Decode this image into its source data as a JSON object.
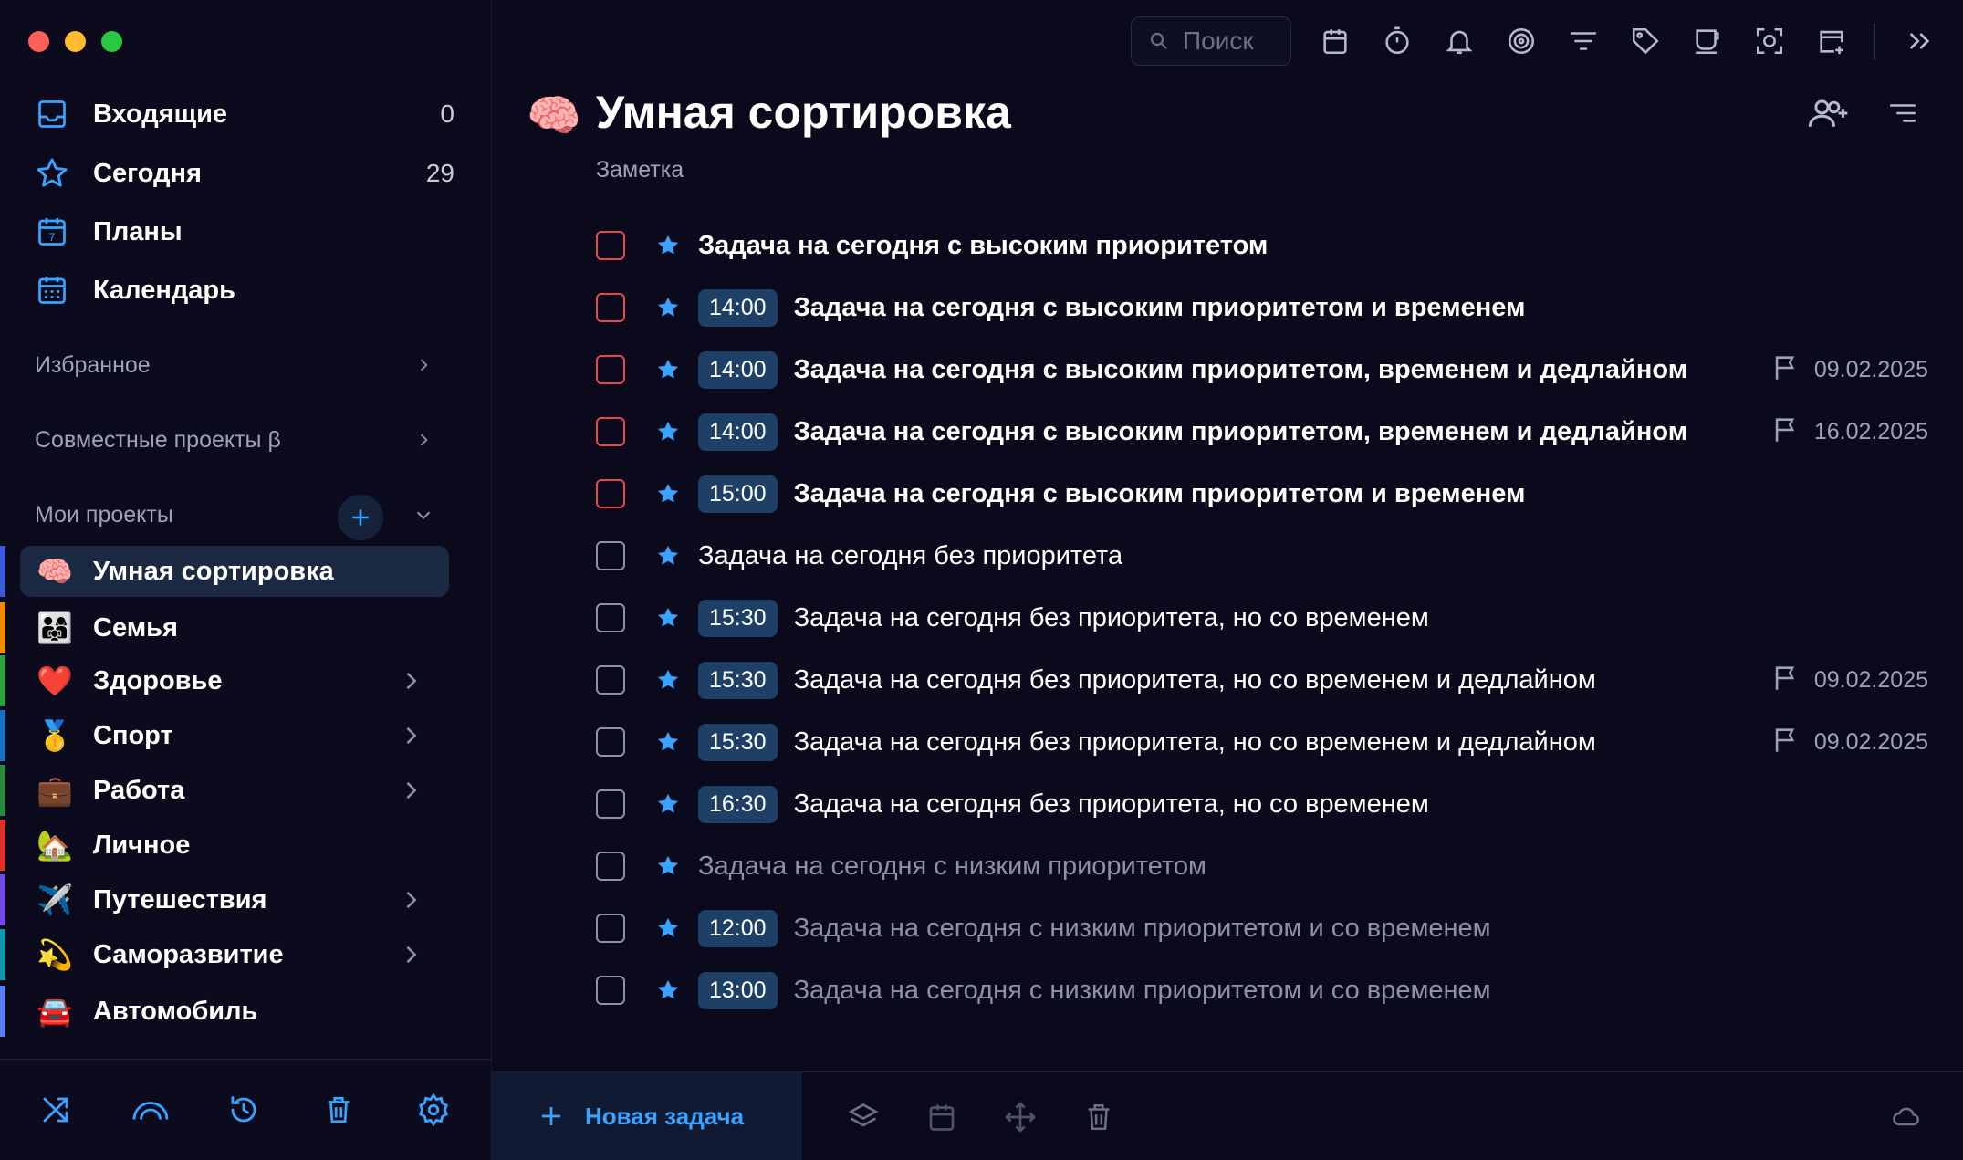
{
  "colors": {
    "accent": "#3aa3ff",
    "high_priority": "#e5484d",
    "time_badge": "#1e4066",
    "active_project": "#1b2942"
  },
  "sidebar": {
    "nav": [
      {
        "label": "Входящие",
        "count": "0",
        "icon": "inbox-icon"
      },
      {
        "label": "Сегодня",
        "count": "29",
        "icon": "star-icon"
      },
      {
        "label": "Планы",
        "count": "",
        "icon": "calendar-7-icon"
      },
      {
        "label": "Календарь",
        "count": "",
        "icon": "calendar-grid-icon"
      }
    ],
    "sections": {
      "favorites": "Избранное",
      "shared": "Совместные проекты β",
      "my_projects": "Мои проекты"
    },
    "projects": [
      {
        "label": "Умная сортировка",
        "emoji": "🧠",
        "bar": "#3b5bdb",
        "chevron": false,
        "active": true
      },
      {
        "label": "Семья",
        "emoji": "👨‍👩‍👧",
        "bar": "#f08c00",
        "chevron": false,
        "active": false
      },
      {
        "label": "Здоровье",
        "emoji": "❤️",
        "bar": "#2f9e44",
        "chevron": true,
        "active": false
      },
      {
        "label": "Спорт",
        "emoji": "🥇",
        "bar": "#1971c2",
        "chevron": true,
        "active": false
      },
      {
        "label": "Работа",
        "emoji": "💼",
        "bar": "#2b8a3e",
        "chevron": true,
        "active": false
      },
      {
        "label": "Личное",
        "emoji": "🏡",
        "bar": "#e03131",
        "chevron": false,
        "active": false
      },
      {
        "label": "Путешествия",
        "emoji": "✈️",
        "bar": "#7048e8",
        "chevron": true,
        "active": false
      },
      {
        "label": "Саморазвитие",
        "emoji": "💫",
        "bar": "#1098ad",
        "chevron": true,
        "active": false
      },
      {
        "label": "Автомобиль",
        "emoji": "🚘",
        "bar": "#5c7cfa",
        "chevron": false,
        "active": false
      }
    ]
  },
  "toolbar": {
    "search_placeholder": "Поиск"
  },
  "header": {
    "emoji": "🧠",
    "title": "Умная сортировка",
    "note": "Заметка"
  },
  "tasks": [
    {
      "title": "Задача на сегодня с высоким приоритетом",
      "time": "",
      "deadline": "",
      "priority": "high"
    },
    {
      "title": "Задача на сегодня с высоким приоритетом и временем",
      "time": "14:00",
      "deadline": "",
      "priority": "high"
    },
    {
      "title": "Задача на сегодня с высоким приоритетом, временем и дедлайном",
      "time": "14:00",
      "deadline": "09.02.2025",
      "priority": "high"
    },
    {
      "title": "Задача на сегодня с высоким приоритетом, временем и дедлайном",
      "time": "14:00",
      "deadline": "16.02.2025",
      "priority": "high"
    },
    {
      "title": "Задача на сегодня с высоким приоритетом и временем",
      "time": "15:00",
      "deadline": "",
      "priority": "high"
    },
    {
      "title": "Задача на сегодня без приоритета",
      "time": "",
      "deadline": "",
      "priority": "none"
    },
    {
      "title": "Задача на сегодня без приоритета, но со временем",
      "time": "15:30",
      "deadline": "",
      "priority": "none"
    },
    {
      "title": "Задача на сегодня без приоритета, но со временем и дедлайном",
      "time": "15:30",
      "deadline": "09.02.2025",
      "priority": "none"
    },
    {
      "title": "Задача на сегодня без приоритета, но со временем и дедлайном",
      "time": "15:30",
      "deadline": "09.02.2025",
      "priority": "none"
    },
    {
      "title": "Задача на сегодня без приоритета, но со временем",
      "time": "16:30",
      "deadline": "",
      "priority": "none"
    },
    {
      "title": "Задача на сегодня с низким приоритетом",
      "time": "",
      "deadline": "",
      "priority": "low"
    },
    {
      "title": "Задача на сегодня с низким приоритетом и со временем",
      "time": "12:00",
      "deadline": "",
      "priority": "low"
    },
    {
      "title": "Задача на сегодня с низким приоритетом и со временем",
      "time": "13:00",
      "deadline": "",
      "priority": "low"
    }
  ],
  "bottom": {
    "new_task_label": "Новая задача"
  }
}
